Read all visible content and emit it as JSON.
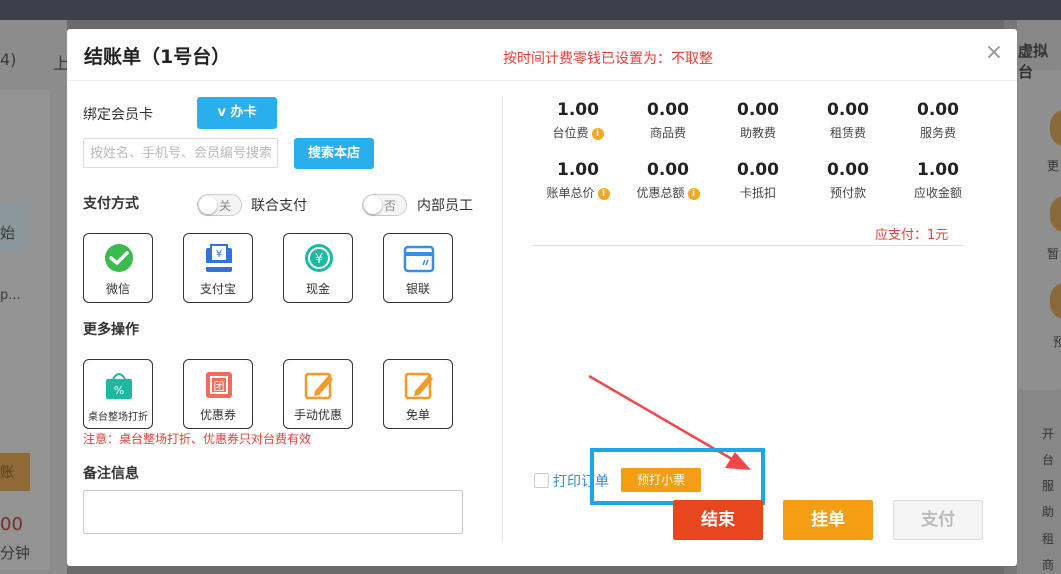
{
  "background": {
    "left_texts": [
      "4)",
      "上",
      "始",
      "p...",
      "账",
      "00",
      "分钟"
    ],
    "right_texts": [
      "虚拟台",
      "更",
      "暂",
      "预",
      "开",
      "台",
      "服",
      "助",
      "租",
      "商"
    ]
  },
  "dialog": {
    "title": "结账单（1号台）",
    "notice": "按时间计费零钱已设置为：不取整",
    "close": "×"
  },
  "member": {
    "label": "绑定会员卡",
    "card_button": "v 办卡",
    "search_placeholder": "按姓名、手机号、会员编号搜索",
    "search_button": "搜索本店"
  },
  "payment": {
    "label": "支付方式",
    "combined_toggle": {
      "state": "关",
      "label": "联合支付"
    },
    "staff_toggle": {
      "state": "否",
      "label": "内部员工"
    },
    "methods": [
      "微信",
      "支付宝",
      "现金",
      "银联"
    ]
  },
  "more": {
    "label": "更多操作",
    "ops": [
      "桌台整场打折",
      "优惠券",
      "手动优惠",
      "免单"
    ],
    "note": "注意：桌台整场打折、优惠券只对台费有效"
  },
  "remark": {
    "label": "备注信息",
    "value": ""
  },
  "summary": {
    "row1": [
      {
        "value": "1.00",
        "label": "台位费",
        "info": true
      },
      {
        "value": "0.00",
        "label": "商品费",
        "info": false
      },
      {
        "value": "0.00",
        "label": "助教费",
        "info": false
      },
      {
        "value": "0.00",
        "label": "租赁费",
        "info": false
      },
      {
        "value": "0.00",
        "label": "服务费",
        "info": false
      }
    ],
    "row2": [
      {
        "value": "1.00",
        "label": "账单总价",
        "info": true
      },
      {
        "value": "0.00",
        "label": "优惠总额",
        "info": true
      },
      {
        "value": "0.00",
        "label": "卡抵扣",
        "info": false
      },
      {
        "value": "0.00",
        "label": "预付款",
        "info": false
      },
      {
        "value": "1.00",
        "label": "应收金额",
        "info": false
      }
    ],
    "due": "应支付：1元",
    "info_glyph": "i"
  },
  "print": {
    "label": "打印订单",
    "pre_print": "预打小票",
    "checked": false
  },
  "actions": {
    "finish": "结束",
    "hang": "挂单",
    "pay": "支付"
  },
  "colors": {
    "accent_blue": "#29b0ec",
    "warning_red": "#e8403a",
    "orange": "#f59d13",
    "finish_red": "#e8461e"
  }
}
